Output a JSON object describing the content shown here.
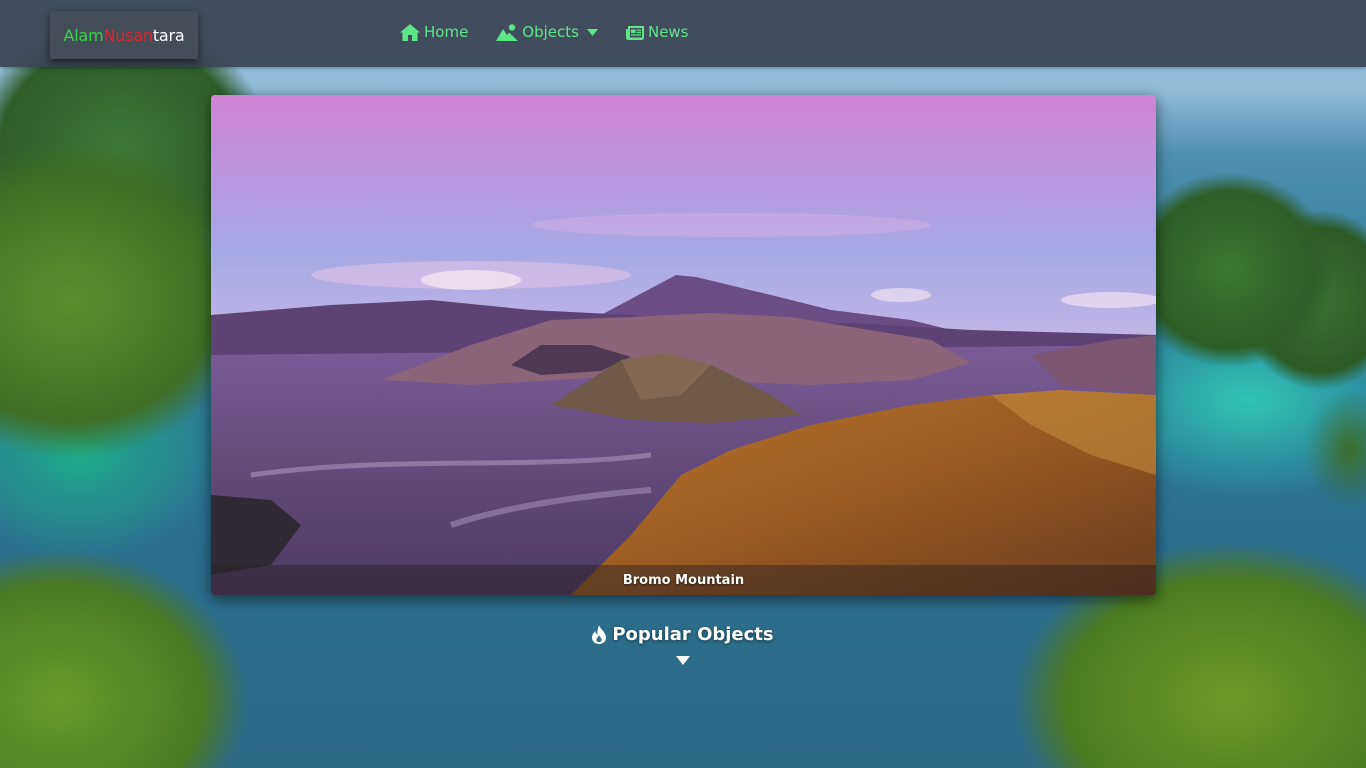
{
  "brand": {
    "part1": "Alam",
    "part2": "Nusan",
    "part3": "tara",
    "colors": {
      "part1": "#35d34a",
      "part2": "#e3242b",
      "part3": "#ffffff"
    }
  },
  "nav": {
    "items": [
      {
        "label": "Home",
        "icon": "home-icon"
      },
      {
        "label": "Objects",
        "icon": "mountain-user-icon",
        "dropdown": true
      },
      {
        "label": "News",
        "icon": "newspaper-icon"
      }
    ],
    "accent_color": "#5ee58a"
  },
  "hero": {
    "caption": "Bromo Mountain"
  },
  "section": {
    "title": "Popular Objects",
    "icon": "fire-icon"
  }
}
